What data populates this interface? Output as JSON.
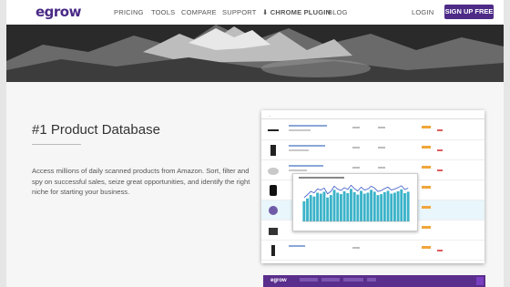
{
  "nav": {
    "logo": "egrow",
    "items": [
      "PRICING",
      "TOOLS",
      "COMPARE",
      "SUPPORT",
      "CHROME PLUGIN",
      "BLOG"
    ],
    "login": "LOGIN",
    "signup": "SIGN UP FREE"
  },
  "section": {
    "title": "#1 Product Database",
    "description": "Access millions of daily scanned products from Amazon. Sort, filter and spy on successful sales, seize great opportunities, and identify the right niche for starting your business."
  },
  "mockup": {
    "chart_values": [
      42,
      48,
      55,
      52,
      60,
      58,
      62,
      50,
      55,
      66,
      60,
      57,
      63,
      59,
      68,
      61,
      56,
      64,
      58,
      60,
      66,
      62,
      55,
      57,
      61,
      64,
      58,
      60,
      63,
      67,
      59,
      62
    ],
    "bottombar_logo": "egrow"
  },
  "colors": {
    "brand": "#4d2b87",
    "chart_bar": "#3bb3c9",
    "chart_line": "#3a57c8"
  }
}
